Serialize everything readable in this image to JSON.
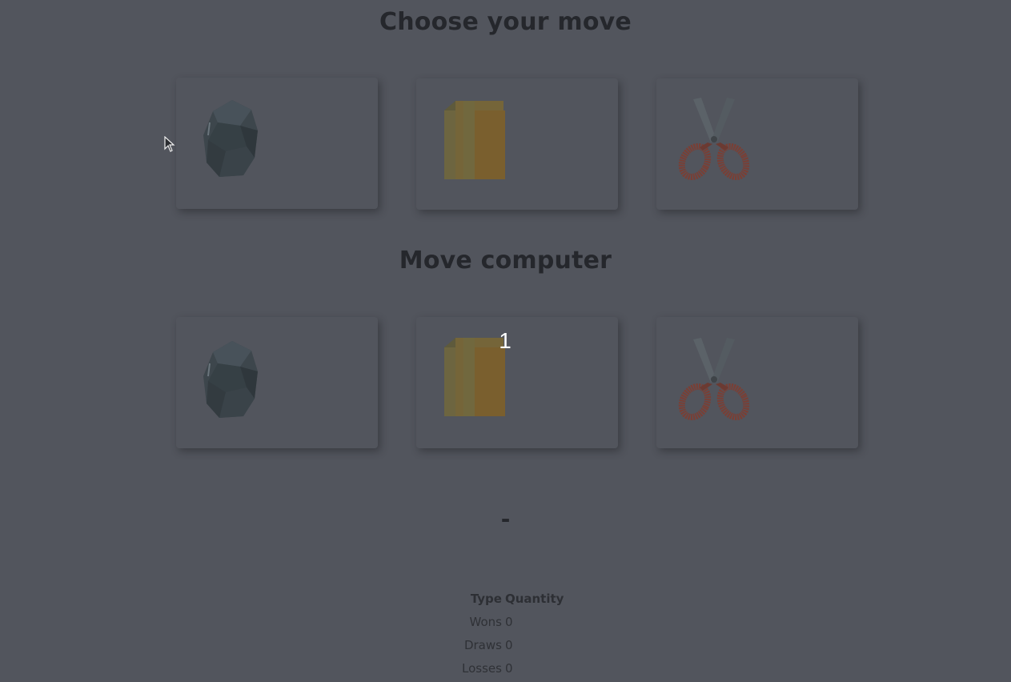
{
  "player": {
    "title": "Choose your move",
    "moves": [
      {
        "name": "rock",
        "icon": "rock-icon"
      },
      {
        "name": "paper",
        "icon": "paper-icon"
      },
      {
        "name": "scissors",
        "icon": "scissors-icon"
      }
    ]
  },
  "computer": {
    "title": "Move computer",
    "countdown": "1",
    "moves": [
      {
        "name": "rock",
        "icon": "rock-icon"
      },
      {
        "name": "paper",
        "icon": "paper-icon"
      },
      {
        "name": "scissors",
        "icon": "scissors-icon"
      }
    ]
  },
  "result": {
    "text": "-"
  },
  "stats": {
    "headers": {
      "type": "Type",
      "quantity": "Quantity"
    },
    "rows": [
      {
        "type": "Wons",
        "quantity": "0"
      },
      {
        "type": "Draws",
        "quantity": "0"
      },
      {
        "type": "Losses",
        "quantity": "0"
      }
    ]
  },
  "colors": {
    "background": "#52555d",
    "heading": "#25272c",
    "rock": "#3f474c",
    "paper": "#7a6a3a",
    "scissors_handle": "#7a3f35",
    "scissors_blade": "#5b6268"
  }
}
